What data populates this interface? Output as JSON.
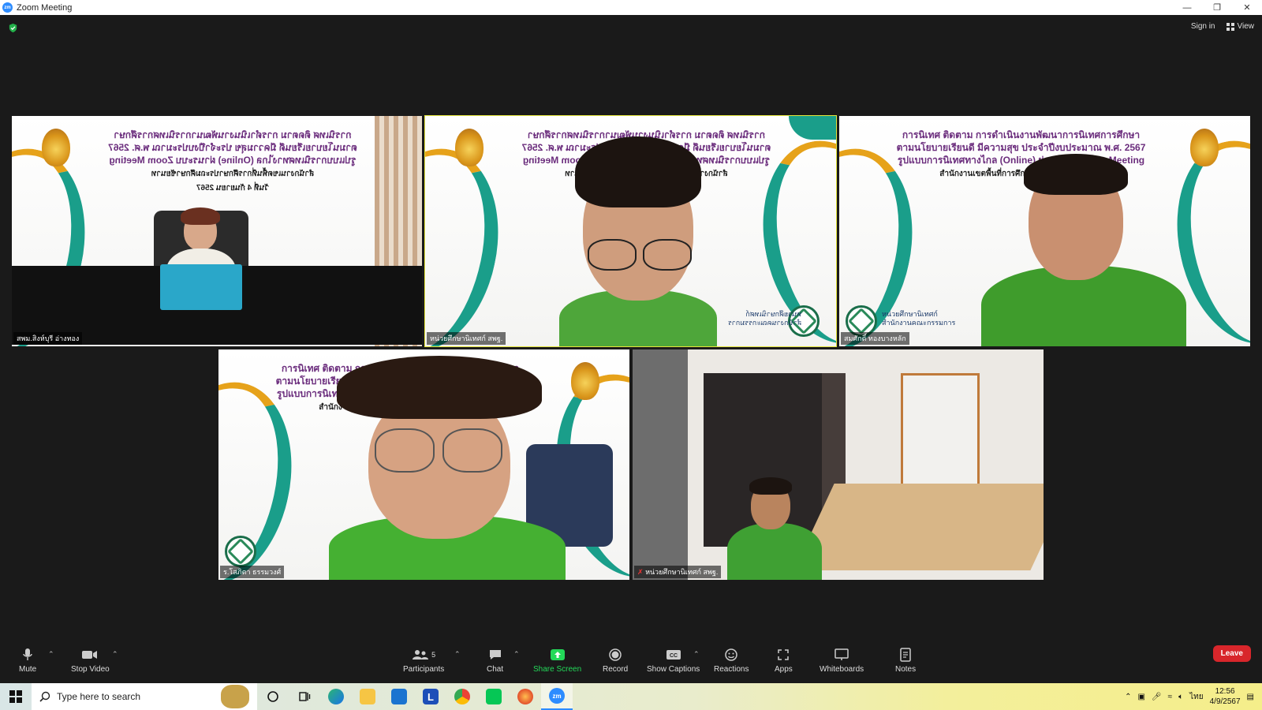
{
  "window": {
    "title": "Zoom Meeting",
    "app_icon_text": "zm"
  },
  "top_right": {
    "sign_in": "Sign in",
    "view": "View"
  },
  "banner": {
    "line1": "การนิเทศ ติดตาม การดำเนินงานพัฒนาการนิเทศการศึกษา",
    "line2": "ตามนโยบายเรียนดี มีความสุข ประจำปีงบประมาณ พ.ศ. 2567",
    "line3": "รูปแบบการนิเทศทางไกล (Online) ผ่านระบบ Zoom Meeting",
    "line4": "สำนักงานเขตพื้นที่การศึกษาประถมศึกษาชัยนาท",
    "date": "วันที่ 4 กันยายน 2567",
    "logo_text_1": "หน่วยศึกษานิเทศก์",
    "logo_text_2": "สำนักงานคณะกรรมการ"
  },
  "participants": [
    {
      "name": "สพม.สิงห์บุรี อ่างทอง"
    },
    {
      "name": "หน่วยศึกษานิเทศก์ สพฐ."
    },
    {
      "name": "สมศักดิ์ ทองบางหลัก"
    },
    {
      "name": "ร.โสภิตา ธรรมวงศ์"
    },
    {
      "name": "หน่วยศึกษานิเทศก์ สพฐ."
    }
  ],
  "toolbar": {
    "mute": "Mute",
    "stop_video": "Stop Video",
    "participants": "Participants",
    "participants_count": "5",
    "chat": "Chat",
    "share_screen": "Share Screen",
    "record": "Record",
    "show_captions": "Show Captions",
    "reactions": "Reactions",
    "apps": "Apps",
    "whiteboards": "Whiteboards",
    "notes": "Notes",
    "leave": "Leave"
  },
  "taskbar": {
    "search_placeholder": "Type here to search",
    "time": "12:56",
    "date": "4/9/2567",
    "lang": "ไทย"
  },
  "colors": {
    "accent_teal": "#1a9e8a",
    "accent_gold": "#e6a21a",
    "active_speaker": "#e5e63a",
    "share_green": "#23d959",
    "leave_red": "#d8262b"
  }
}
